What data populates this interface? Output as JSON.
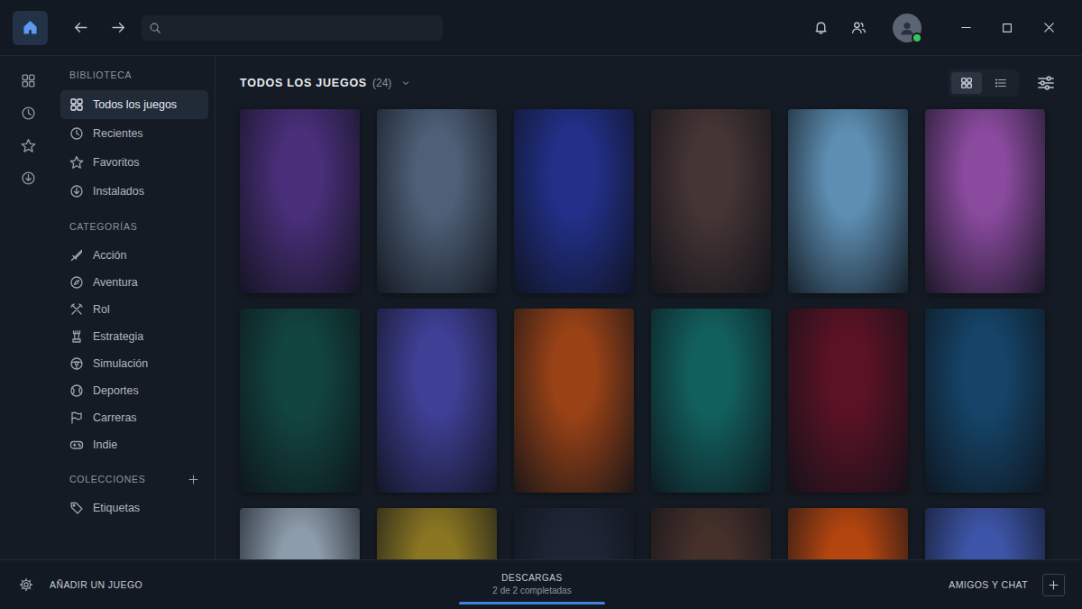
{
  "topbar": {
    "home": {
      "selected": true
    },
    "user": {
      "online": true
    }
  },
  "rail": [
    {
      "selected": false
    },
    {
      "selected": false
    },
    {
      "selected": false
    },
    {
      "selected": false
    }
  ],
  "sidebar": {
    "sections": [
      {
        "title": "BIBLIOTECA",
        "addable": false,
        "items": [
          {
            "label": "Todos los juegos",
            "selected": true
          },
          {
            "label": "Recientes",
            "selected": false
          },
          {
            "label": "Favoritos",
            "selected": false
          },
          {
            "label": "Instalados",
            "selected": false
          }
        ]
      },
      {
        "title": "CATEGORÍAS",
        "addable": false,
        "items": [
          {
            "label": "Acción",
            "selected": false
          },
          {
            "label": "Aventura",
            "selected": false
          },
          {
            "label": "Rol",
            "selected": false
          },
          {
            "label": "Estrategia",
            "selected": false
          },
          {
            "label": "Simulación",
            "selected": false
          },
          {
            "label": "Deportes",
            "selected": false
          },
          {
            "label": "Carreras",
            "selected": false
          },
          {
            "label": "Indie",
            "selected": false
          }
        ]
      },
      {
        "title": "COLECCIONES",
        "addable": true,
        "items": [
          {
            "label": "Etiquetas",
            "selected": false
          }
        ]
      }
    ]
  },
  "library": {
    "title": "TODOS LOS JUEGOS",
    "count": "(24)",
    "views": [
      {
        "selected": true
      },
      {
        "selected": false
      }
    ]
  },
  "games": [
    {
      "color": "#4a2f7a"
    },
    {
      "color": "#4e6077"
    },
    {
      "color": "#22308a"
    },
    {
      "color": "#463535"
    },
    {
      "color": "#5e8fb3"
    },
    {
      "color": "#8a4a9e"
    },
    {
      "color": "#124540"
    },
    {
      "color": "#3f3f95"
    },
    {
      "color": "#9a4216"
    },
    {
      "color": "#12605e"
    },
    {
      "color": "#5a1224"
    },
    {
      "color": "#154468"
    },
    {
      "color": "#8d9cab"
    },
    {
      "color": "#8a7622"
    },
    {
      "color": "#1e2636"
    },
    {
      "color": "#45302a"
    },
    {
      "color": "#b4450f"
    },
    {
      "color": "#3d55a8"
    }
  ],
  "footer": {
    "add_game": "AÑADIR UN JUEGO",
    "downloads": {
      "title": "DESCARGAS",
      "status": "2 de 2 completadas",
      "level": 1
    },
    "friends": "AMIGOS Y CHAT"
  }
}
